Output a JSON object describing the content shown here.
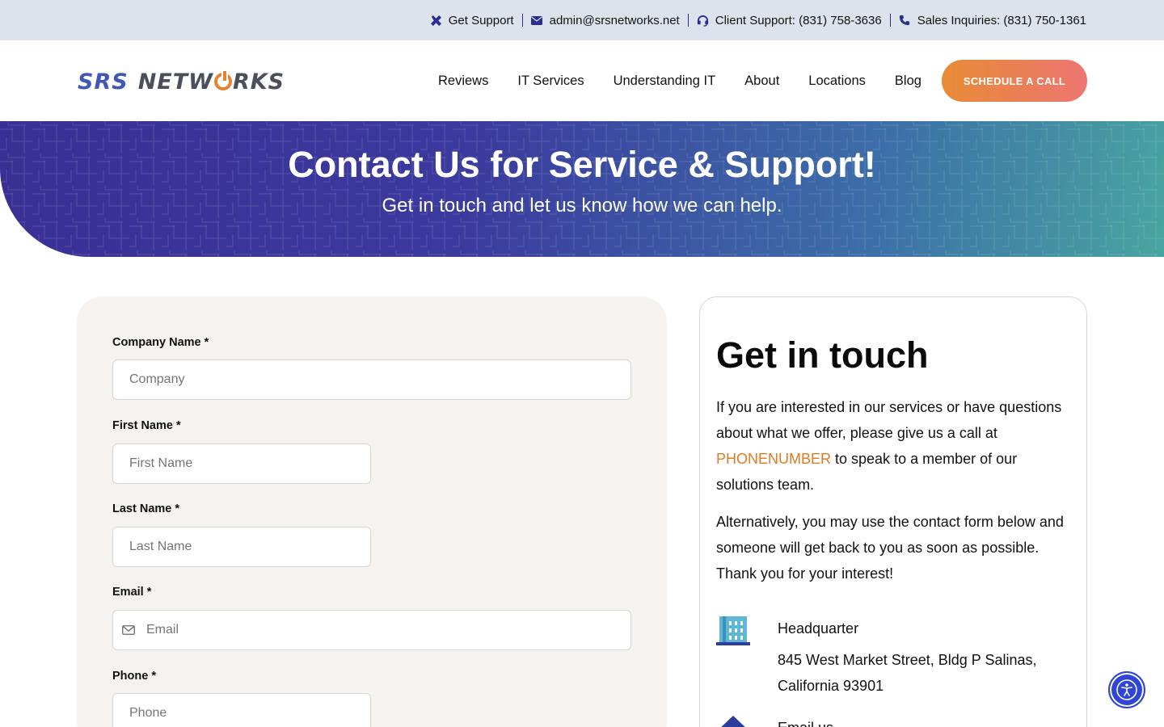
{
  "topbar": {
    "support_label": "Get Support",
    "email": "admin@srsnetworks.net",
    "client_support": "Client Support: (831) 758-3636",
    "sales": "Sales Inquiries: (831) 750-1361",
    "icon_color": "#2a2f8f"
  },
  "header": {
    "logo_srs": "SRS",
    "logo_net_a": "NETW",
    "logo_net_b": "RKS",
    "nav": [
      "Reviews",
      "IT Services",
      "Understanding IT",
      "About",
      "Locations",
      "Blog"
    ],
    "cta_label": "SCHEDULE A CALL",
    "cta_colors": [
      "#e88b35",
      "#ec7672"
    ]
  },
  "hero": {
    "title": "Contact Us for Service & Support!",
    "subtitle": "Get in touch and let us know how we can help."
  },
  "form": {
    "company_label": "Company Name *",
    "company_placeholder": "Company",
    "first_label": "First Name *",
    "first_placeholder": "First Name",
    "last_label": "Last Name *",
    "last_placeholder": "Last Name",
    "email_label": "Email *",
    "email_placeholder": "Email",
    "phone_label": "Phone *",
    "phone_placeholder": "Phone"
  },
  "info": {
    "title": "Get in touch",
    "p1_a": "If you are interested in our services or have questions about what we offer, please give us a call at ",
    "p1_phone": "PHONENUMBER",
    "p1_b": " to speak to a member of our solutions team.",
    "p2": "Alternatively, you may use the contact form below and someone will get back to you as soon as possible. Thank you for your interest!",
    "hq_title": "Headquarter",
    "hq_address": "845 West Market Street, Bldg P Salinas, California 93901",
    "email_title": "Email us",
    "accent_color": "#e07a22"
  },
  "icons": {
    "support": "tools-icon",
    "email": "envelope-icon",
    "client": "headset-icon",
    "sales": "phone-icon",
    "hq": "building-icon",
    "email_us": "envelope-open-icon",
    "accessibility": "accessibility-icon"
  }
}
